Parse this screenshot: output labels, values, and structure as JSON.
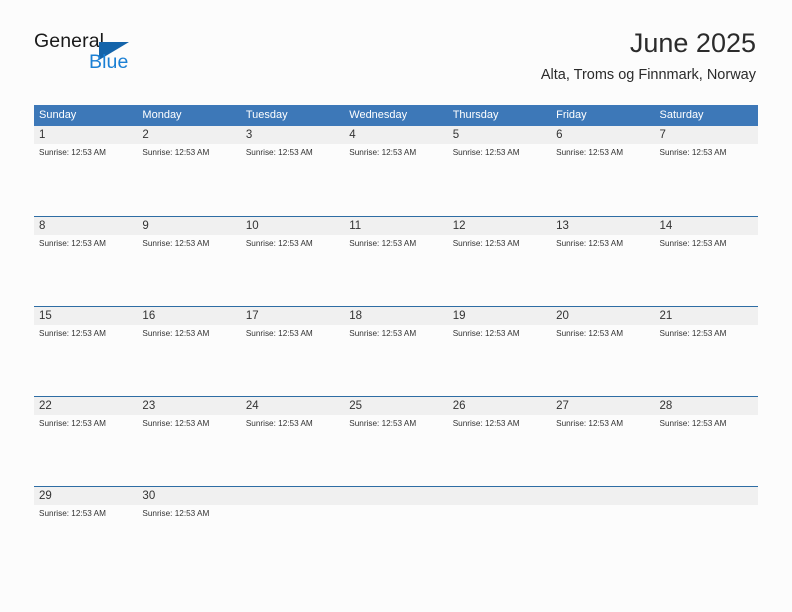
{
  "brand": {
    "name_part1": "General",
    "name_part2": "Blue",
    "triangle_icon": "triangle-icon"
  },
  "header": {
    "title": "June 2025",
    "subtitle": "Alta, Troms og Finnmark, Norway"
  },
  "colors": {
    "header_blue": "#3d78b8",
    "row_border_blue": "#2e6da4",
    "brand_blue": "#1a7fd4",
    "daynum_band": "#f0f0f0",
    "page_background": "#fcfcfc"
  },
  "calendar": {
    "weekday_headers": [
      "Sunday",
      "Monday",
      "Tuesday",
      "Wednesday",
      "Thursday",
      "Friday",
      "Saturday"
    ],
    "weeks": [
      {
        "days": [
          {
            "number": "1",
            "event": "Sunrise: 12:53 AM"
          },
          {
            "number": "2",
            "event": "Sunrise: 12:53 AM"
          },
          {
            "number": "3",
            "event": "Sunrise: 12:53 AM"
          },
          {
            "number": "4",
            "event": "Sunrise: 12:53 AM"
          },
          {
            "number": "5",
            "event": "Sunrise: 12:53 AM"
          },
          {
            "number": "6",
            "event": "Sunrise: 12:53 AM"
          },
          {
            "number": "7",
            "event": "Sunrise: 12:53 AM"
          }
        ]
      },
      {
        "days": [
          {
            "number": "8",
            "event": "Sunrise: 12:53 AM"
          },
          {
            "number": "9",
            "event": "Sunrise: 12:53 AM"
          },
          {
            "number": "10",
            "event": "Sunrise: 12:53 AM"
          },
          {
            "number": "11",
            "event": "Sunrise: 12:53 AM"
          },
          {
            "number": "12",
            "event": "Sunrise: 12:53 AM"
          },
          {
            "number": "13",
            "event": "Sunrise: 12:53 AM"
          },
          {
            "number": "14",
            "event": "Sunrise: 12:53 AM"
          }
        ]
      },
      {
        "days": [
          {
            "number": "15",
            "event": "Sunrise: 12:53 AM"
          },
          {
            "number": "16",
            "event": "Sunrise: 12:53 AM"
          },
          {
            "number": "17",
            "event": "Sunrise: 12:53 AM"
          },
          {
            "number": "18",
            "event": "Sunrise: 12:53 AM"
          },
          {
            "number": "19",
            "event": "Sunrise: 12:53 AM"
          },
          {
            "number": "20",
            "event": "Sunrise: 12:53 AM"
          },
          {
            "number": "21",
            "event": "Sunrise: 12:53 AM"
          }
        ]
      },
      {
        "days": [
          {
            "number": "22",
            "event": "Sunrise: 12:53 AM"
          },
          {
            "number": "23",
            "event": "Sunrise: 12:53 AM"
          },
          {
            "number": "24",
            "event": "Sunrise: 12:53 AM"
          },
          {
            "number": "25",
            "event": "Sunrise: 12:53 AM"
          },
          {
            "number": "26",
            "event": "Sunrise: 12:53 AM"
          },
          {
            "number": "27",
            "event": "Sunrise: 12:53 AM"
          },
          {
            "number": "28",
            "event": "Sunrise: 12:53 AM"
          }
        ]
      },
      {
        "days": [
          {
            "number": "29",
            "event": "Sunrise: 12:53 AM"
          },
          {
            "number": "30",
            "event": "Sunrise: 12:53 AM"
          },
          {
            "number": "",
            "event": ""
          },
          {
            "number": "",
            "event": ""
          },
          {
            "number": "",
            "event": ""
          },
          {
            "number": "",
            "event": ""
          },
          {
            "number": "",
            "event": ""
          }
        ]
      }
    ]
  }
}
